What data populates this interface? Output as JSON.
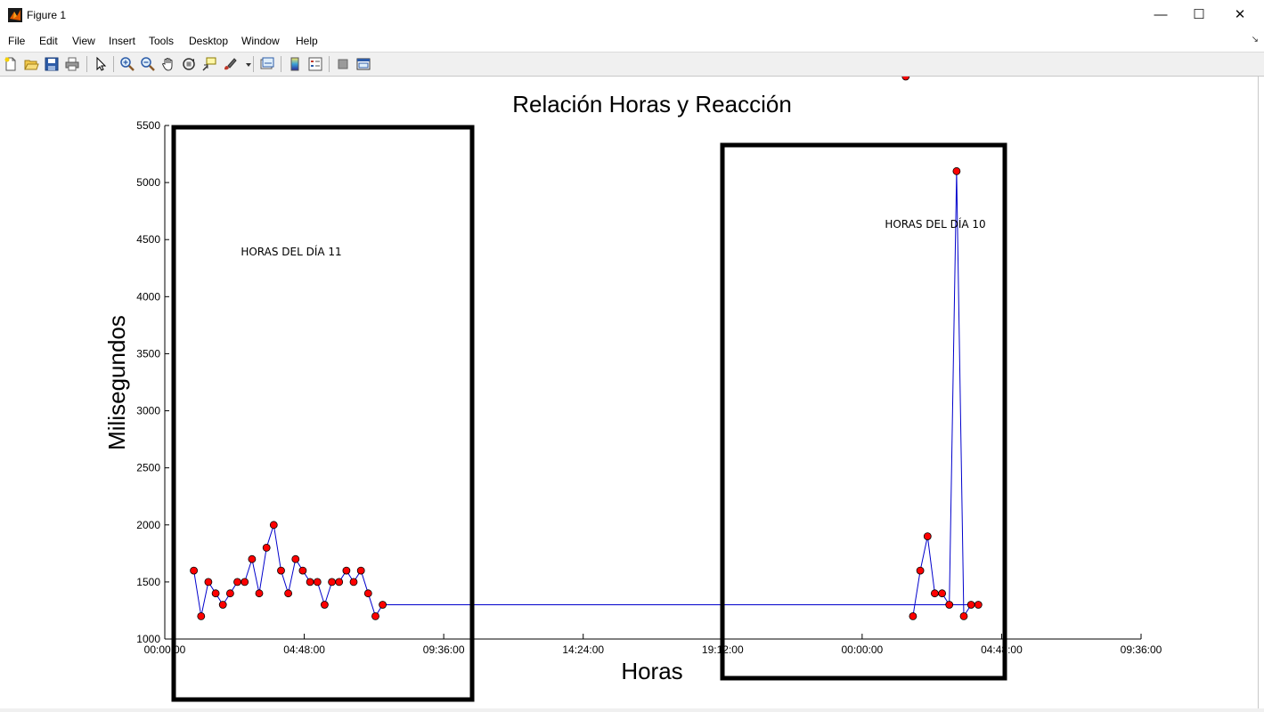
{
  "window": {
    "title": "Figure 1",
    "minimize_glyph": "—",
    "maximize_glyph": "☐",
    "close_glyph": "✕"
  },
  "menu": [
    "File",
    "Edit",
    "View",
    "Insert",
    "Tools",
    "Desktop",
    "Window",
    "Help"
  ],
  "toolbar_icons": [
    "new-figure-icon",
    "open-file-icon",
    "save-icon",
    "print-icon",
    "pointer-icon",
    "zoom-in-icon",
    "zoom-out-icon",
    "pan-icon",
    "rotate-3d-icon",
    "data-cursor-icon",
    "brush-icon",
    "link-plot-icon",
    "colorbar-icon",
    "legend-icon",
    "hide-plot-tools-icon",
    "show-plot-tools-icon"
  ],
  "chart_data": {
    "type": "line",
    "title": "Relación Horas y Reacción",
    "xlabel": "Horas",
    "ylabel": "Milisegundos",
    "x_ticks": [
      "00:00:00",
      "04:48:00",
      "09:36:00",
      "14:24:00",
      "19:12:00",
      "00:00:00",
      "04:48:00",
      "09:36:00"
    ],
    "y_ticks": [
      "1000",
      "1500",
      "2000",
      "2500",
      "3000",
      "3500",
      "4000",
      "4500",
      "5000",
      "5500"
    ],
    "xlim_hours": [
      0,
      33.6
    ],
    "ylim": [
      1000,
      5500
    ],
    "marker_color": "#ff0000",
    "line_color": "#0000cc",
    "series": [
      {
        "x_hours": [
          1.0,
          1.25,
          1.5,
          1.75,
          2.0,
          2.25,
          2.5,
          2.75,
          3.0,
          3.25,
          3.5,
          3.75,
          4.0,
          4.25,
          4.5,
          4.75,
          5.0,
          5.25,
          5.5,
          5.75,
          6.0,
          6.25,
          6.5,
          6.75,
          7.0,
          7.25,
          7.5,
          28.0,
          27.75,
          27.5,
          27.25,
          27.0,
          26.75,
          26.5,
          26.25,
          26.0,
          25.75,
          25.5
        ],
        "values": [
          1600,
          1200,
          1500,
          1400,
          1300,
          1400,
          1500,
          1500,
          1700,
          1400,
          1800,
          2000,
          1600,
          1400,
          1700,
          1600,
          1500,
          1500,
          1300,
          1500,
          1500,
          1600,
          1500,
          1600,
          1400,
          1200,
          1300,
          1300,
          1300,
          1200,
          5100,
          1300,
          1400,
          1400,
          1900,
          1600,
          1200
        ]
      }
    ],
    "annotations": [
      {
        "text": "HORAS DEL DÍA 11"
      },
      {
        "text": "HORAS DEL DÍA 10"
      }
    ]
  }
}
